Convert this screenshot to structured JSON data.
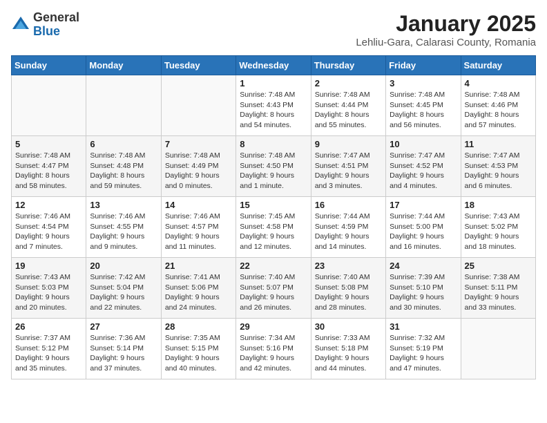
{
  "logo": {
    "general": "General",
    "blue": "Blue"
  },
  "title": "January 2025",
  "location": "Lehliu-Gara, Calarasi County, Romania",
  "days_header": [
    "Sunday",
    "Monday",
    "Tuesday",
    "Wednesday",
    "Thursday",
    "Friday",
    "Saturday"
  ],
  "weeks": [
    [
      {
        "day": "",
        "sunrise": "",
        "sunset": "",
        "daylight": ""
      },
      {
        "day": "",
        "sunrise": "",
        "sunset": "",
        "daylight": ""
      },
      {
        "day": "",
        "sunrise": "",
        "sunset": "",
        "daylight": ""
      },
      {
        "day": "1",
        "sunrise": "Sunrise: 7:48 AM",
        "sunset": "Sunset: 4:43 PM",
        "daylight": "Daylight: 8 hours and 54 minutes."
      },
      {
        "day": "2",
        "sunrise": "Sunrise: 7:48 AM",
        "sunset": "Sunset: 4:44 PM",
        "daylight": "Daylight: 8 hours and 55 minutes."
      },
      {
        "day": "3",
        "sunrise": "Sunrise: 7:48 AM",
        "sunset": "Sunset: 4:45 PM",
        "daylight": "Daylight: 8 hours and 56 minutes."
      },
      {
        "day": "4",
        "sunrise": "Sunrise: 7:48 AM",
        "sunset": "Sunset: 4:46 PM",
        "daylight": "Daylight: 8 hours and 57 minutes."
      }
    ],
    [
      {
        "day": "5",
        "sunrise": "Sunrise: 7:48 AM",
        "sunset": "Sunset: 4:47 PM",
        "daylight": "Daylight: 8 hours and 58 minutes."
      },
      {
        "day": "6",
        "sunrise": "Sunrise: 7:48 AM",
        "sunset": "Sunset: 4:48 PM",
        "daylight": "Daylight: 8 hours and 59 minutes."
      },
      {
        "day": "7",
        "sunrise": "Sunrise: 7:48 AM",
        "sunset": "Sunset: 4:49 PM",
        "daylight": "Daylight: 9 hours and 0 minutes."
      },
      {
        "day": "8",
        "sunrise": "Sunrise: 7:48 AM",
        "sunset": "Sunset: 4:50 PM",
        "daylight": "Daylight: 9 hours and 1 minute."
      },
      {
        "day": "9",
        "sunrise": "Sunrise: 7:47 AM",
        "sunset": "Sunset: 4:51 PM",
        "daylight": "Daylight: 9 hours and 3 minutes."
      },
      {
        "day": "10",
        "sunrise": "Sunrise: 7:47 AM",
        "sunset": "Sunset: 4:52 PM",
        "daylight": "Daylight: 9 hours and 4 minutes."
      },
      {
        "day": "11",
        "sunrise": "Sunrise: 7:47 AM",
        "sunset": "Sunset: 4:53 PM",
        "daylight": "Daylight: 9 hours and 6 minutes."
      }
    ],
    [
      {
        "day": "12",
        "sunrise": "Sunrise: 7:46 AM",
        "sunset": "Sunset: 4:54 PM",
        "daylight": "Daylight: 9 hours and 7 minutes."
      },
      {
        "day": "13",
        "sunrise": "Sunrise: 7:46 AM",
        "sunset": "Sunset: 4:55 PM",
        "daylight": "Daylight: 9 hours and 9 minutes."
      },
      {
        "day": "14",
        "sunrise": "Sunrise: 7:46 AM",
        "sunset": "Sunset: 4:57 PM",
        "daylight": "Daylight: 9 hours and 11 minutes."
      },
      {
        "day": "15",
        "sunrise": "Sunrise: 7:45 AM",
        "sunset": "Sunset: 4:58 PM",
        "daylight": "Daylight: 9 hours and 12 minutes."
      },
      {
        "day": "16",
        "sunrise": "Sunrise: 7:44 AM",
        "sunset": "Sunset: 4:59 PM",
        "daylight": "Daylight: 9 hours and 14 minutes."
      },
      {
        "day": "17",
        "sunrise": "Sunrise: 7:44 AM",
        "sunset": "Sunset: 5:00 PM",
        "daylight": "Daylight: 9 hours and 16 minutes."
      },
      {
        "day": "18",
        "sunrise": "Sunrise: 7:43 AM",
        "sunset": "Sunset: 5:02 PM",
        "daylight": "Daylight: 9 hours and 18 minutes."
      }
    ],
    [
      {
        "day": "19",
        "sunrise": "Sunrise: 7:43 AM",
        "sunset": "Sunset: 5:03 PM",
        "daylight": "Daylight: 9 hours and 20 minutes."
      },
      {
        "day": "20",
        "sunrise": "Sunrise: 7:42 AM",
        "sunset": "Sunset: 5:04 PM",
        "daylight": "Daylight: 9 hours and 22 minutes."
      },
      {
        "day": "21",
        "sunrise": "Sunrise: 7:41 AM",
        "sunset": "Sunset: 5:06 PM",
        "daylight": "Daylight: 9 hours and 24 minutes."
      },
      {
        "day": "22",
        "sunrise": "Sunrise: 7:40 AM",
        "sunset": "Sunset: 5:07 PM",
        "daylight": "Daylight: 9 hours and 26 minutes."
      },
      {
        "day": "23",
        "sunrise": "Sunrise: 7:40 AM",
        "sunset": "Sunset: 5:08 PM",
        "daylight": "Daylight: 9 hours and 28 minutes."
      },
      {
        "day": "24",
        "sunrise": "Sunrise: 7:39 AM",
        "sunset": "Sunset: 5:10 PM",
        "daylight": "Daylight: 9 hours and 30 minutes."
      },
      {
        "day": "25",
        "sunrise": "Sunrise: 7:38 AM",
        "sunset": "Sunset: 5:11 PM",
        "daylight": "Daylight: 9 hours and 33 minutes."
      }
    ],
    [
      {
        "day": "26",
        "sunrise": "Sunrise: 7:37 AM",
        "sunset": "Sunset: 5:12 PM",
        "daylight": "Daylight: 9 hours and 35 minutes."
      },
      {
        "day": "27",
        "sunrise": "Sunrise: 7:36 AM",
        "sunset": "Sunset: 5:14 PM",
        "daylight": "Daylight: 9 hours and 37 minutes."
      },
      {
        "day": "28",
        "sunrise": "Sunrise: 7:35 AM",
        "sunset": "Sunset: 5:15 PM",
        "daylight": "Daylight: 9 hours and 40 minutes."
      },
      {
        "day": "29",
        "sunrise": "Sunrise: 7:34 AM",
        "sunset": "Sunset: 5:16 PM",
        "daylight": "Daylight: 9 hours and 42 minutes."
      },
      {
        "day": "30",
        "sunrise": "Sunrise: 7:33 AM",
        "sunset": "Sunset: 5:18 PM",
        "daylight": "Daylight: 9 hours and 44 minutes."
      },
      {
        "day": "31",
        "sunrise": "Sunrise: 7:32 AM",
        "sunset": "Sunset: 5:19 PM",
        "daylight": "Daylight: 9 hours and 47 minutes."
      },
      {
        "day": "",
        "sunrise": "",
        "sunset": "",
        "daylight": ""
      }
    ]
  ]
}
